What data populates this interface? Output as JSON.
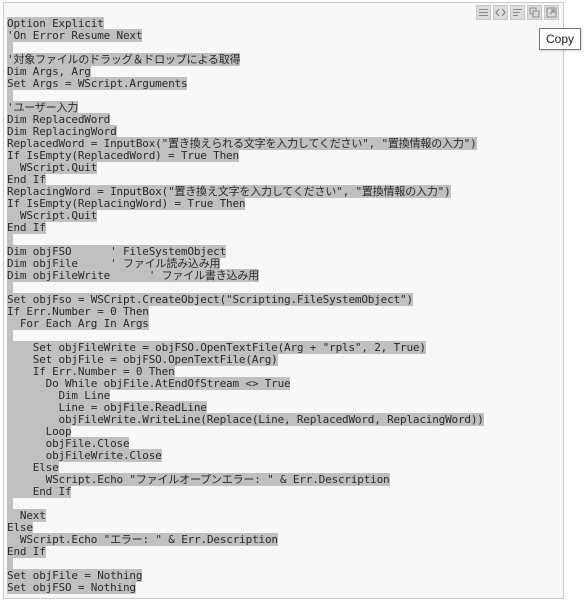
{
  "toolbar": {
    "buttons": [
      {
        "icon": "view-source-icon"
      },
      {
        "icon": "code-icon"
      },
      {
        "icon": "wrap-lines-icon"
      },
      {
        "icon": "copy-icon"
      },
      {
        "icon": "open-window-icon"
      }
    ]
  },
  "tooltip": {
    "label": "Copy"
  },
  "code": {
    "lines": [
      "Option Explicit",
      "'On Error Resume Next",
      "",
      "'対象ファイルのドラッグ＆ドロップによる取得",
      "Dim Args, Arg",
      "Set Args = WScript.Arguments",
      "",
      "'ユーザー入力",
      "Dim ReplacedWord",
      "Dim ReplacingWord",
      "ReplacedWord = InputBox(\"置き換えられる文字を入力してください\", \"置換情報の入力\")",
      "If IsEmpty(ReplacedWord) = True Then",
      "  WScript.Quit",
      "End If",
      "ReplacingWord = InputBox(\"置き換え文字を入力してください\", \"置換情報の入力\")",
      "If IsEmpty(ReplacingWord) = True Then",
      "  WScript.Quit",
      "End If",
      "",
      "Dim objFSO      ' FileSystemObject",
      "Dim objFile     ' ファイル読み込み用",
      "Dim objFileWrite      ' ファイル書き込み用",
      "",
      "Set objFso = WSCript.CreateObject(\"Scripting.FileSystemObject\")",
      "If Err.Number = 0 Then",
      "  For Each Arg In Args",
      "",
      "    Set objFileWrite = objFSO.OpenTextFile(Arg + \"rpls\", 2, True)",
      "    Set objFile = objFSO.OpenTextFile(Arg)",
      "    If Err.Number = 0 Then",
      "      Do While objFile.AtEndOfStream <> True",
      "        Dim Line",
      "        Line = objFile.ReadLine",
      "        objFileWrite.WriteLine(Replace(Line, ReplacedWord, ReplacingWord))",
      "      Loop",
      "      objFile.Close",
      "      objFileWrite.Close",
      "    Else",
      "      WScript.Echo \"ファイルオープンエラー: \" & Err.Description",
      "    End If",
      "",
      "  Next",
      "Else",
      "  WScript.Echo \"エラー: \" & Err.Description",
      "End If",
      "",
      "Set objFile = Nothing",
      "Set objFSO = Nothing"
    ]
  },
  "colors": {
    "highlight": "#c0c0c0",
    "panel_bg": "#f8f8f8",
    "text": "#2a2a2a"
  }
}
